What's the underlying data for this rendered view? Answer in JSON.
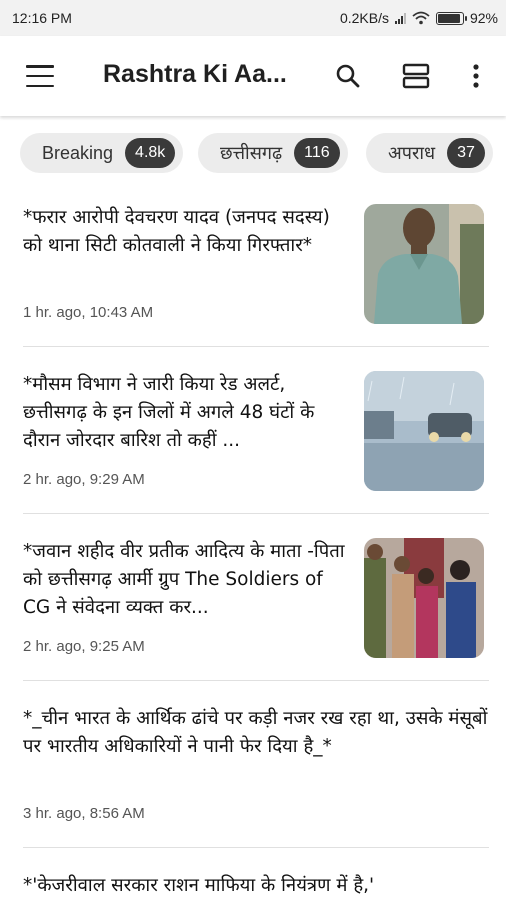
{
  "status_bar": {
    "time": "12:16 PM",
    "net_speed": "0.2KB/s",
    "battery": "92%",
    "battery_level": 0.92
  },
  "app_bar": {
    "title": "Rashtra Ki Aa..."
  },
  "chips": [
    {
      "label": "Breaking",
      "count": "4.8k"
    },
    {
      "label": "छत्तीसगढ़",
      "count": "116"
    },
    {
      "label": "अपराध",
      "count": "37"
    }
  ],
  "stories": [
    {
      "headline": "*फरार आरोपी देवचरण यादव (जनपद सदस्य) को थाना सिटी कोतवाली ने किया गिरफ्तार*",
      "time": "1 hr. ago, 10:43 AM",
      "thumbnail": "man-in-green-shirt"
    },
    {
      "headline": "*मौसम विभाग ने जारी किया रेड अलर्ट, छत्तीसगढ़ के इन जिलों में अगले 48 घंटों के दौरान जोरदार बारिश तो कहीं ...",
      "time": "2 hr. ago, 9:29 AM",
      "thumbnail": "cars-in-heavy-rain"
    },
    {
      "headline": "*जवान शहीद वीर प्रतीक आदित्य के माता -पिता को छत्तीसगढ़ आर्मी ग्रुप The Soldiers of CG ने संवेदना व्यक्त कर...",
      "time": "2 hr. ago, 9:25 AM",
      "thumbnail": "group-with-soldier"
    },
    {
      "headline": "*_चीन भारत के आर्थिक ढांचे पर कड़ी नजर रख रहा था, उसके मंसूबों पर भारतीय अधिकारियों ने पानी फेर दिया है_*",
      "time": "3 hr. ago, 8:56 AM"
    },
    {
      "headline": "*'केजरीवाल सरकार राशन माफिया के नियंत्रण में है,'"
    }
  ]
}
